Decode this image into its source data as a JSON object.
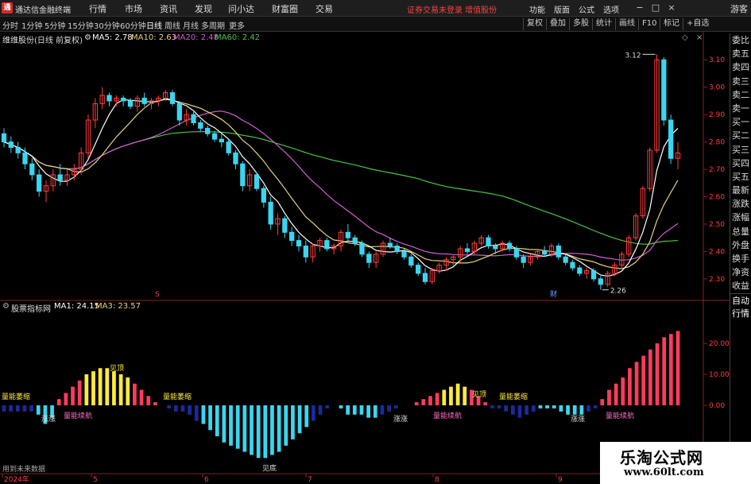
{
  "menubar": {
    "app_title": "通达信金融终端",
    "items": [
      "行情",
      "市场",
      "资讯",
      "发现",
      "问小达",
      "财富圈",
      "交易"
    ],
    "notice": "证券交易未登录  增值股份",
    "right_items": [
      "功能",
      "版面",
      "公式",
      "选项"
    ],
    "guest": "游客"
  },
  "toolbar": {
    "periods": [
      "分时",
      "1分钟",
      "5分钟",
      "15分钟",
      "30分钟",
      "60分钟",
      "日线",
      "周线",
      "月线",
      "多周期",
      "更多"
    ],
    "active_period": "日线",
    "tools": [
      "复权",
      "叠加",
      "多股",
      "统计",
      "画线",
      "F10",
      "标记",
      "+自选"
    ]
  },
  "main_chart": {
    "title": "维维股份(日线 前复权)",
    "ma5_label": "MA5: 2.78",
    "ma10_label": "MA10: 2.63",
    "ma20_label": "MA20: 2.48",
    "ma60_label": "MA60: 2.42",
    "high_label": "3.12",
    "low_label": "2.26",
    "markers": [
      "S",
      "财"
    ],
    "ylim": [
      2.23,
      3.15
    ],
    "yticks": [
      "3.10",
      "3.00",
      "2.90",
      "2.80",
      "2.70",
      "2.60",
      "2.50",
      "2.40",
      "2.30"
    ]
  },
  "sub_chart": {
    "title": "股票指标网",
    "ma1_label": "MA1: 24.15",
    "ma3_label": "MA3: 23.57",
    "yticks": [
      "20.00",
      "10.00",
      "0.00"
    ],
    "annotations": {
      "shrink": "量能萎缩",
      "continue": "量能续航",
      "peak": "见顶",
      "surge": "涨涨",
      "bottom": "见底"
    }
  },
  "side_panel": {
    "items": [
      "委比",
      "卖五",
      "卖四",
      "卖三",
      "卖二",
      "卖一",
      "买一",
      "买二",
      "买三",
      "买四",
      "买五",
      "最新",
      "涨跌",
      "涨幅",
      "总量",
      "外盘",
      "换手",
      "净资",
      "收益",
      "自动",
      "行情"
    ]
  },
  "x_axis": {
    "labels": [
      "2024年",
      "5",
      "6",
      "7",
      "8",
      "9"
    ]
  },
  "bottom_note": "用到未来数据",
  "watermark": {
    "main": "乐淘公式网",
    "url": "www.60lt.com"
  },
  "colors": {
    "up": "#ff3d3d",
    "down": "#3ad6f0",
    "ma5": "#ffffff",
    "ma10": "#e8d37a",
    "ma20": "#d060d0",
    "ma60": "#49c449",
    "bar_pos": "#ff3b5c",
    "bar_peak": "#ffeb3b",
    "bar_neg": "#3ad6f0",
    "bar_neg_dark": "#1a2a9a"
  },
  "chart_data": {
    "type": "candlestick",
    "candles": [
      [
        2.83,
        2.85,
        2.78,
        2.8
      ],
      [
        2.8,
        2.82,
        2.76,
        2.78
      ],
      [
        2.78,
        2.8,
        2.74,
        2.76
      ],
      [
        2.76,
        2.78,
        2.7,
        2.72
      ],
      [
        2.72,
        2.74,
        2.66,
        2.68
      ],
      [
        2.68,
        2.7,
        2.6,
        2.62
      ],
      [
        2.62,
        2.66,
        2.58,
        2.64
      ],
      [
        2.64,
        2.7,
        2.62,
        2.68
      ],
      [
        2.68,
        2.72,
        2.64,
        2.66
      ],
      [
        2.66,
        2.7,
        2.64,
        2.68
      ],
      [
        2.68,
        2.72,
        2.66,
        2.7
      ],
      [
        2.7,
        2.78,
        2.68,
        2.76
      ],
      [
        2.76,
        2.9,
        2.74,
        2.88
      ],
      [
        2.88,
        2.96,
        2.85,
        2.94
      ],
      [
        2.94,
        3.0,
        2.92,
        2.97
      ],
      [
        2.97,
        2.98,
        2.93,
        2.95
      ],
      [
        2.95,
        2.97,
        2.93,
        2.96
      ],
      [
        2.96,
        2.97,
        2.93,
        2.95
      ],
      [
        2.95,
        2.96,
        2.92,
        2.93
      ],
      [
        2.93,
        2.97,
        2.91,
        2.96
      ],
      [
        2.96,
        2.98,
        2.93,
        2.94
      ],
      [
        2.94,
        2.96,
        2.92,
        2.95
      ],
      [
        2.95,
        2.97,
        2.93,
        2.96
      ],
      [
        2.96,
        2.99,
        2.95,
        2.98
      ],
      [
        2.98,
        2.99,
        2.93,
        2.94
      ],
      [
        2.94,
        2.95,
        2.86,
        2.88
      ],
      [
        2.88,
        2.92,
        2.86,
        2.9
      ],
      [
        2.9,
        2.91,
        2.86,
        2.87
      ],
      [
        2.87,
        2.88,
        2.84,
        2.85
      ],
      [
        2.85,
        2.86,
        2.82,
        2.83
      ],
      [
        2.83,
        2.84,
        2.8,
        2.81
      ],
      [
        2.81,
        2.83,
        2.78,
        2.8
      ],
      [
        2.8,
        2.81,
        2.75,
        2.76
      ],
      [
        2.76,
        2.77,
        2.7,
        2.72
      ],
      [
        2.72,
        2.73,
        2.62,
        2.64
      ],
      [
        2.64,
        2.7,
        2.62,
        2.68
      ],
      [
        2.68,
        2.69,
        2.62,
        2.63
      ],
      [
        2.63,
        2.64,
        2.56,
        2.58
      ],
      [
        2.58,
        2.6,
        2.48,
        2.5
      ],
      [
        2.5,
        2.54,
        2.46,
        2.52
      ],
      [
        2.52,
        2.53,
        2.45,
        2.47
      ],
      [
        2.47,
        2.49,
        2.42,
        2.44
      ],
      [
        2.44,
        2.46,
        2.4,
        2.42
      ],
      [
        2.42,
        2.44,
        2.36,
        2.38
      ],
      [
        2.38,
        2.43,
        2.36,
        2.42
      ],
      [
        2.42,
        2.45,
        2.4,
        2.44
      ],
      [
        2.44,
        2.45,
        2.4,
        2.41
      ],
      [
        2.41,
        2.43,
        2.39,
        2.42
      ],
      [
        2.42,
        2.48,
        2.4,
        2.47
      ],
      [
        2.47,
        2.5,
        2.44,
        2.45
      ],
      [
        2.45,
        2.46,
        2.42,
        2.43
      ],
      [
        2.43,
        2.44,
        2.38,
        2.39
      ],
      [
        2.39,
        2.4,
        2.34,
        2.36
      ],
      [
        2.36,
        2.4,
        2.34,
        2.39
      ],
      [
        2.39,
        2.44,
        2.38,
        2.43
      ],
      [
        2.43,
        2.45,
        2.41,
        2.42
      ],
      [
        2.42,
        2.43,
        2.39,
        2.4
      ],
      [
        2.4,
        2.41,
        2.37,
        2.38
      ],
      [
        2.38,
        2.39,
        2.34,
        2.35
      ],
      [
        2.35,
        2.36,
        2.31,
        2.32
      ],
      [
        2.32,
        2.34,
        2.28,
        2.29
      ],
      [
        2.29,
        2.34,
        2.28,
        2.33
      ],
      [
        2.33,
        2.36,
        2.32,
        2.35
      ],
      [
        2.35,
        2.38,
        2.33,
        2.37
      ],
      [
        2.37,
        2.39,
        2.35,
        2.38
      ],
      [
        2.38,
        2.42,
        2.36,
        2.41
      ],
      [
        2.41,
        2.43,
        2.39,
        2.4
      ],
      [
        2.4,
        2.44,
        2.39,
        2.43
      ],
      [
        2.43,
        2.46,
        2.42,
        2.45
      ],
      [
        2.45,
        2.46,
        2.41,
        2.42
      ],
      [
        2.42,
        2.43,
        2.39,
        2.41
      ],
      [
        2.41,
        2.44,
        2.4,
        2.43
      ],
      [
        2.43,
        2.44,
        2.4,
        2.41
      ],
      [
        2.41,
        2.42,
        2.37,
        2.38
      ],
      [
        2.38,
        2.39,
        2.34,
        2.36
      ],
      [
        2.36,
        2.39,
        2.35,
        2.38
      ],
      [
        2.38,
        2.41,
        2.37,
        2.4
      ],
      [
        2.4,
        2.42,
        2.38,
        2.39
      ],
      [
        2.39,
        2.43,
        2.38,
        2.42
      ],
      [
        2.42,
        2.43,
        2.37,
        2.38
      ],
      [
        2.38,
        2.39,
        2.35,
        2.36
      ],
      [
        2.36,
        2.37,
        2.33,
        2.34
      ],
      [
        2.34,
        2.35,
        2.31,
        2.32
      ],
      [
        2.32,
        2.34,
        2.3,
        2.33
      ],
      [
        2.33,
        2.34,
        2.29,
        2.3
      ],
      [
        2.3,
        2.31,
        2.26,
        2.28
      ],
      [
        2.28,
        2.33,
        2.27,
        2.32
      ],
      [
        2.32,
        2.36,
        2.31,
        2.35
      ],
      [
        2.35,
        2.4,
        2.34,
        2.39
      ],
      [
        2.39,
        2.46,
        2.38,
        2.45
      ],
      [
        2.45,
        2.54,
        2.44,
        2.53
      ],
      [
        2.53,
        2.64,
        2.52,
        2.63
      ],
      [
        2.63,
        2.78,
        2.62,
        2.77
      ],
      [
        2.77,
        3.12,
        2.76,
        3.1
      ],
      [
        3.1,
        3.11,
        2.86,
        2.88
      ],
      [
        2.88,
        2.9,
        2.72,
        2.74
      ],
      [
        2.74,
        2.8,
        2.7,
        2.76
      ]
    ],
    "subchart": [
      -2,
      -2,
      -2,
      -2,
      -2,
      -3,
      -6,
      -4,
      2,
      4,
      6,
      8,
      10,
      11,
      12,
      12,
      11,
      10,
      9,
      7,
      5,
      3,
      1,
      0,
      -1,
      -2,
      -2,
      -3,
      -5,
      -6,
      -8,
      -10,
      -12,
      -13,
      -14,
      -15,
      -16,
      -17,
      -17,
      -16,
      -15,
      -13,
      -11,
      -9,
      -7,
      -5,
      -3,
      -1,
      0,
      -1,
      -3,
      -3,
      -3,
      -4,
      -4,
      -3,
      -2,
      -1,
      0,
      0,
      1,
      2,
      3,
      4,
      5,
      6,
      7,
      6,
      5,
      3,
      1,
      -1,
      -1,
      -2,
      -3,
      -4,
      -3,
      -2,
      -1,
      -1,
      -1,
      -2,
      -3,
      -3,
      -3,
      -2,
      -1,
      2,
      5,
      7,
      9,
      12,
      14,
      16,
      18,
      20,
      22,
      23,
      24
    ]
  }
}
